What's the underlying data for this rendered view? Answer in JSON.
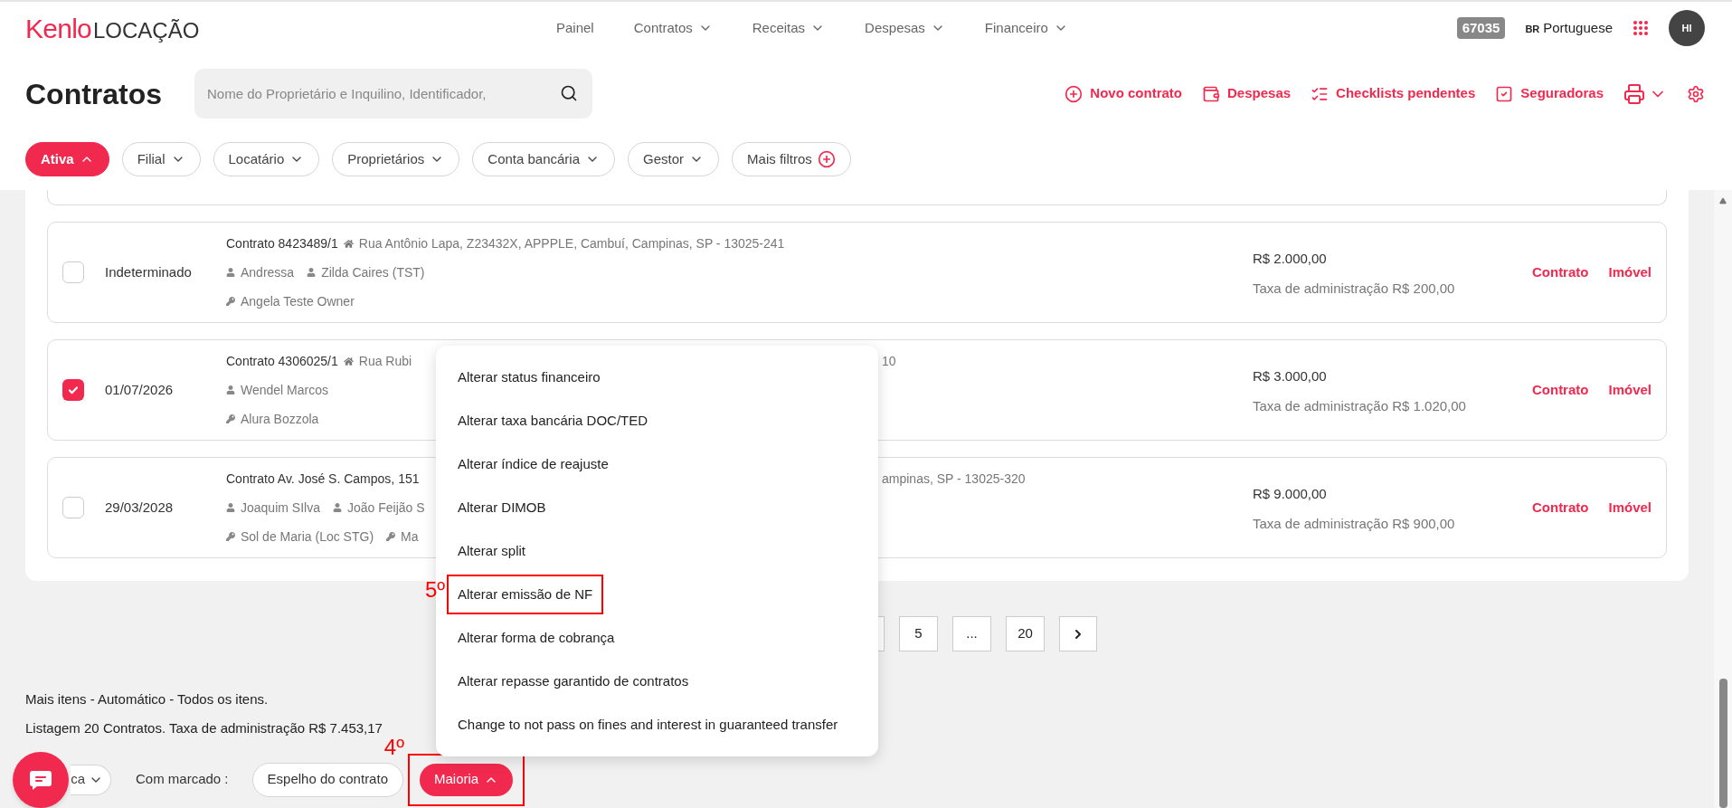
{
  "header": {
    "logo_brand": "Kenlo",
    "logo_product": "LOCAÇÃO",
    "nav": [
      {
        "label": "Painel",
        "dropdown": false
      },
      {
        "label": "Contratos",
        "dropdown": true
      },
      {
        "label": "Receitas",
        "dropdown": true
      },
      {
        "label": "Despesas",
        "dropdown": true
      },
      {
        "label": "Financeiro",
        "dropdown": true
      }
    ],
    "account_id": "67035",
    "language_code": "BR",
    "language": "Portuguese",
    "avatar_initials": "HI"
  },
  "page": {
    "title": "Contratos",
    "search_placeholder": "Nome do Proprietário e Inquilino, Identificador,",
    "actions": [
      {
        "kind": "new",
        "label": "Novo contrato"
      },
      {
        "kind": "expenses",
        "label": "Despesas"
      },
      {
        "kind": "checklist",
        "label": "Checklists pendentes"
      },
      {
        "kind": "insurers",
        "label": "Seguradoras"
      }
    ],
    "filters": [
      {
        "label": "Ativa",
        "kind": "dropdown",
        "selected": true
      },
      {
        "label": "Filial",
        "kind": "dropdown",
        "selected": false
      },
      {
        "label": "Locatário",
        "kind": "dropdown",
        "selected": false
      },
      {
        "label": "Proprietários",
        "kind": "dropdown",
        "selected": false
      },
      {
        "label": "Conta bancária",
        "kind": "dropdown",
        "selected": false
      },
      {
        "label": "Gestor",
        "kind": "dropdown",
        "selected": false
      },
      {
        "label": "Mais filtros",
        "kind": "more",
        "selected": false
      }
    ]
  },
  "contracts": [
    {
      "checked": false,
      "date": "Indeterminado",
      "title": "Contrato 8423489/1",
      "address": "Rua Antônio Lapa, Z23432X, APPPLE, Cambuí, Campinas, SP - 13025-241",
      "tenants": [
        "Andressa",
        "Zilda Caires (TST)"
      ],
      "owners": [
        "Angela Teste Owner"
      ],
      "value": "R$ 2.000,00",
      "fee": "Taxa de administração R$ 200,00",
      "links": [
        "Contrato",
        "Imóvel"
      ]
    },
    {
      "checked": true,
      "date": "01/07/2026",
      "title": "Contrato 4306025/1",
      "address": "Rua Rubi",
      "address_tail": "10",
      "tenants": [
        "Wendel Marcos"
      ],
      "owners": [
        "Alura Bozzola"
      ],
      "value": "R$ 3.000,00",
      "fee": "Taxa de administração R$ 1.020,00",
      "links": [
        "Contrato",
        "Imóvel"
      ]
    },
    {
      "checked": false,
      "date": "29/03/2028",
      "title": "Contrato Av. José S. Campos, 151",
      "address_tail": "ampinas, SP - 13025-320",
      "tenants": [
        "Joaquim SIlva",
        "João Feijão S"
      ],
      "owners": [
        "Sol de Maria (Loc STG)",
        "Ma"
      ],
      "value": "R$ 9.000,00",
      "fee": "Taxa de administração R$ 900,00",
      "links": [
        "Contrato",
        "Imóvel"
      ]
    }
  ],
  "pagination": {
    "pages": [
      "5",
      "...",
      "20"
    ]
  },
  "summary": [
    "Mais itens - Automático - Todos os itens.",
    "Listagem 20 Contratos. Taxa de administração R$ 7.453,17"
  ],
  "bottom_bar": {
    "selection_dropdown": "ca",
    "marked_label": "Com marcado :",
    "buttons": [
      {
        "label": "Espelho do contrato",
        "kind": "outline"
      },
      {
        "label": "Maioria",
        "kind": "primary",
        "expanded": true,
        "annotation": "4º"
      }
    ]
  },
  "menu": [
    {
      "label": "Alterar status financeiro"
    },
    {
      "label": "Alterar taxa bancária DOC/TED"
    },
    {
      "label": "Alterar índice de reajuste"
    },
    {
      "label": "Alterar DIMOB"
    },
    {
      "label": "Alterar split"
    },
    {
      "label": "Alterar emissão de NF",
      "annotation": "5º"
    },
    {
      "label": "Alterar forma de cobrança"
    },
    {
      "label": "Alterar repasse garantido de contratos"
    },
    {
      "label": "Change to not pass on fines and interest in guaranteed transfer"
    }
  ]
}
